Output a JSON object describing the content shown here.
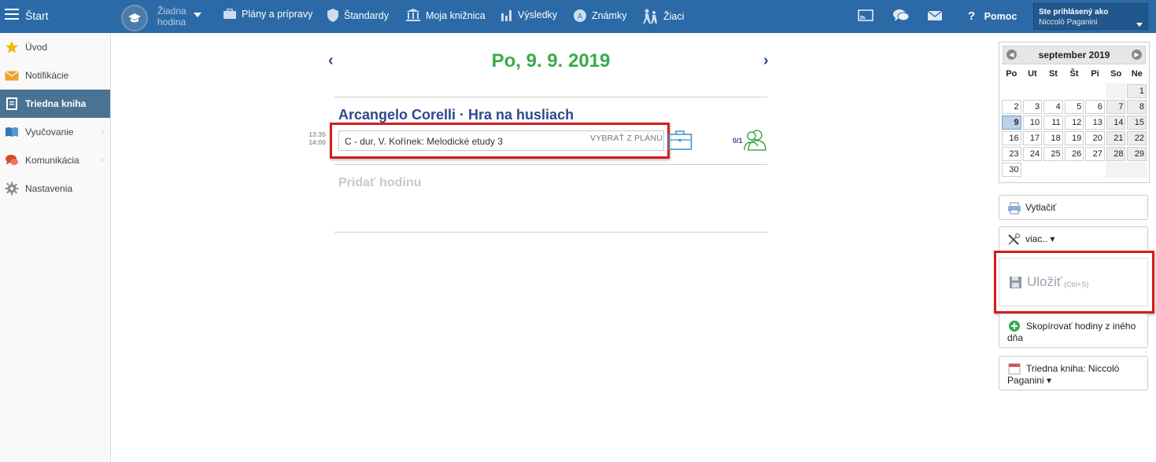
{
  "topbar": {
    "start_label": "Štart",
    "lesson_label_1": "Žiadna",
    "lesson_label_2": "hodina",
    "nav": {
      "plans": "Plány a prípravy",
      "standards": "Štandardy",
      "library": "Moja knižnica",
      "results": "Výsledky",
      "grades": "Známky",
      "students": "Žiaci"
    },
    "help_mark": "?",
    "help": "Pomoc",
    "user_label": "Ste prihlásený ako",
    "user_name": "Niccolò Paganini"
  },
  "sidebar": {
    "items": [
      {
        "label": "Úvod",
        "icon": "star-icon"
      },
      {
        "label": "Notifikácie",
        "icon": "envelope-icon"
      },
      {
        "label": "Triedna kniha",
        "icon": "book-icon",
        "active": true
      },
      {
        "label": "Vyučovanie",
        "icon": "open-book-icon",
        "has_submenu": true
      },
      {
        "label": "Komunikácia",
        "icon": "chat-icon",
        "has_submenu": true
      },
      {
        "label": "Nastavenia",
        "icon": "gear-icon"
      }
    ]
  },
  "main": {
    "date_title": "Po, 9. 9. 2019",
    "prev_arrow": "‹",
    "next_arrow": "›",
    "lesson": {
      "title": "Arcangelo Corelli · Hra na husliach",
      "time_start": "13:35",
      "time_end": "14:00",
      "topic": "C - dur, V. Kořínek: Melodické etudy 3",
      "plan_button": "VYBRAŤ Z PLÁNU",
      "attendance": "0/1"
    },
    "add_lesson": "Pridať hodinu"
  },
  "calendar": {
    "month": "september 2019",
    "prev": "◀",
    "next": "▶",
    "weekdays": [
      "Po",
      "Ut",
      "St",
      "Št",
      "Pi",
      "So",
      "Ne"
    ],
    "weeks": [
      [
        "",
        "",
        "",
        "",
        "",
        "",
        "1"
      ],
      [
        "2",
        "3",
        "4",
        "5",
        "6",
        "7",
        "8"
      ],
      [
        "9",
        "10",
        "11",
        "12",
        "13",
        "14",
        "15"
      ],
      [
        "16",
        "17",
        "18",
        "19",
        "20",
        "21",
        "22"
      ],
      [
        "23",
        "24",
        "25",
        "26",
        "27",
        "28",
        "29"
      ],
      [
        "30",
        "",
        "",
        "",
        "",
        "",
        ""
      ]
    ],
    "selected": "9"
  },
  "actions": {
    "print": "Vytlačiť",
    "more": "viac.. ▾",
    "save": "Uložiť",
    "save_hint": "(Ctrl+S)",
    "copy": "Skopírovať hodiny z iného dňa",
    "classbook": "Triedna kniha: Niccolò Paganini ▾"
  },
  "colors": {
    "topbar": "#2b6aa7",
    "date_green": "#3aaa4a",
    "highlight_red": "#d41c1c",
    "active_sidebar": "#4a7293"
  }
}
